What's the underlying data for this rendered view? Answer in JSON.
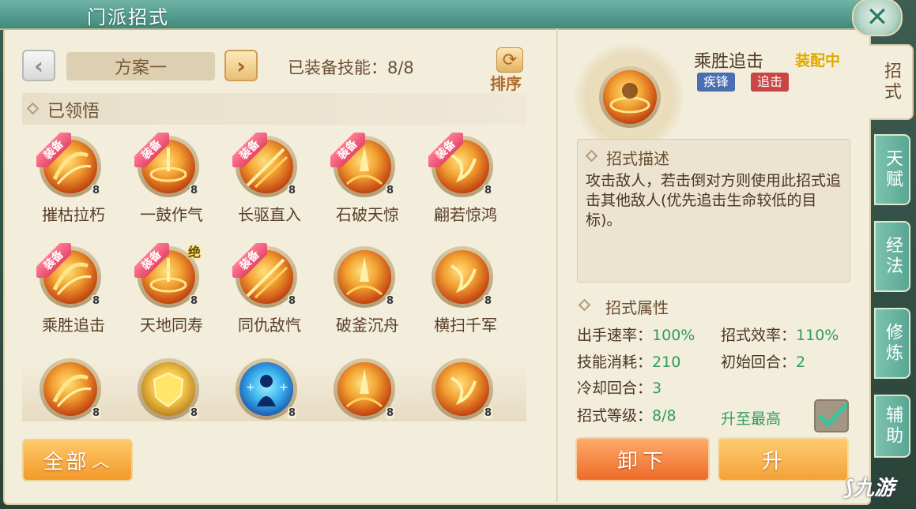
{
  "window": {
    "title": "门派招式"
  },
  "toolbar": {
    "prev_icon": "chevron-left-icon",
    "next_icon": "chevron-right-icon",
    "plan_name": "方案一",
    "equipped_label": "已装备技能：8/8",
    "sort_label": "排序",
    "sort_icon": "refresh-icon"
  },
  "learned": {
    "title": "已领悟"
  },
  "skills": [
    {
      "name": "摧枯拉朽",
      "level": "8",
      "equipped": true,
      "badge": "装备"
    },
    {
      "name": "一鼓作气",
      "level": "8",
      "equipped": true,
      "badge": "装备"
    },
    {
      "name": "长驱直入",
      "level": "8",
      "equipped": true,
      "badge": "装备"
    },
    {
      "name": "石破天惊",
      "level": "8",
      "equipped": true,
      "badge": "装备"
    },
    {
      "name": "翩若惊鸿",
      "level": "8",
      "equipped": true,
      "badge": "装备"
    },
    {
      "name": "乘胜追击",
      "level": "8",
      "equipped": true,
      "badge": "装备"
    },
    {
      "name": "天地同寿",
      "level": "8",
      "equipped": true,
      "badge": "装备",
      "mark": "绝"
    },
    {
      "name": "同仇敌忾",
      "level": "8",
      "equipped": true,
      "badge": "装备"
    },
    {
      "name": "破釜沉舟",
      "level": "8",
      "equipped": false
    },
    {
      "name": "横扫千军",
      "level": "8",
      "equipped": false
    },
    {
      "name": "",
      "level": "8",
      "equipped": false
    },
    {
      "name": "",
      "level": "8",
      "equipped": false,
      "style": "shield"
    },
    {
      "name": "",
      "level": "8",
      "equipped": false,
      "style": "blue"
    },
    {
      "name": "",
      "level": "8",
      "equipped": false
    },
    {
      "name": "",
      "level": "8",
      "equipped": false
    }
  ],
  "filter": {
    "all_label": "全部"
  },
  "detail": {
    "name": "乘胜追击",
    "status": "装配中",
    "tags": [
      "疾锋",
      "追击"
    ],
    "desc_title": "招式描述",
    "desc_text": "攻击敌人，若击倒对方则使用此招式追击其他敌人(优先追击生命较低的目标)。",
    "attr_title": "招式属性",
    "attrs": {
      "speed_label": "出手速率：",
      "speed_value": "100%",
      "efficiency_label": "招式效率：",
      "efficiency_value": "110%",
      "cost_label": "技能消耗：",
      "cost_value": "210",
      "start_label": "初始回合：",
      "start_value": "2",
      "cooldown_label": "冷却回合：",
      "cooldown_value": "3",
      "grade_label": "招式等级：",
      "grade_value": "8/8"
    },
    "max_label": "升至最高",
    "unequip_label": "卸下",
    "upgrade_label": "升"
  },
  "side_tabs": [
    "招式",
    "天赋",
    "经法",
    "修炼",
    "辅助"
  ],
  "watermark": "九游",
  "colors": {
    "accent": "#f29a2a",
    "equip_badge": "#e5466a",
    "attr_value": "#2e9e5c",
    "tab": "#5aa692"
  }
}
